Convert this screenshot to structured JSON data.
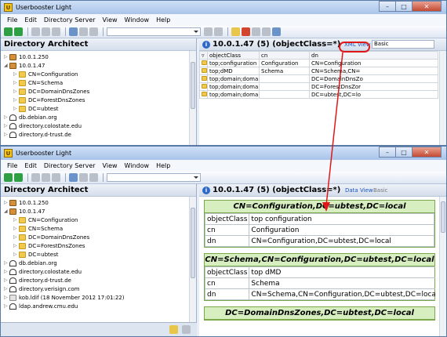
{
  "app": {
    "title": "Userbooster Light"
  },
  "menu": [
    "File",
    "Edit",
    "Directory Server",
    "View",
    "Window",
    "Help"
  ],
  "window1": {
    "pane_title": "Directory Architect",
    "tree": [
      {
        "label": "10.0.1.250",
        "icon": "server-icon",
        "indent": 0,
        "toggle": "▷"
      },
      {
        "label": "10.0.1.47",
        "icon": "server-icon",
        "indent": 0,
        "toggle": "◢"
      },
      {
        "label": "CN=Configuration",
        "icon": "folder-icon",
        "indent": 1,
        "toggle": "▷"
      },
      {
        "label": "CN=Schema",
        "icon": "folder-icon",
        "indent": 1,
        "toggle": "▷"
      },
      {
        "label": "DC=DomainDnsZones",
        "icon": "folder-icon",
        "indent": 1,
        "toggle": "▷"
      },
      {
        "label": "DC=ForestDnsZones",
        "icon": "folder-icon",
        "indent": 1,
        "toggle": "▷"
      },
      {
        "label": "DC=ubtest",
        "icon": "folder-icon",
        "indent": 1,
        "toggle": "▷"
      },
      {
        "label": "db.debian.org",
        "icon": "link-icon",
        "indent": 0,
        "toggle": "▷"
      },
      {
        "label": "directory.colostate.edu",
        "icon": "link-icon",
        "indent": 0,
        "toggle": "▷"
      },
      {
        "label": "directory.d-trust.de",
        "icon": "link-icon",
        "indent": 0,
        "toggle": "▷"
      }
    ],
    "right_title": "10.0.1.47 (5) (objectClass=*)",
    "xml_view": "XML View",
    "basic_field": "Basic",
    "columns": [
      "objectClass",
      "cn",
      "dn"
    ],
    "rows": [
      [
        "top;configuration",
        "Configuration",
        "CN=Configuration"
      ],
      [
        "top;dMD",
        "Schema",
        "CN=Schema,CN="
      ],
      [
        "top;domain;doma",
        "",
        "DC=DomainDnsZo"
      ],
      [
        "top;domain;doma",
        "",
        "DC=ForestDnsZor"
      ],
      [
        "top;domain;doma",
        "",
        "DC=ubtest,DC=lo"
      ]
    ]
  },
  "window2": {
    "pane_title": "Directory Architect",
    "tree": [
      {
        "label": "10.0.1.250",
        "icon": "server-icon",
        "indent": 0,
        "toggle": "▷"
      },
      {
        "label": "10.0.1.47",
        "icon": "server-icon",
        "indent": 0,
        "toggle": "◢"
      },
      {
        "label": "CN=Configuration",
        "icon": "folder-icon",
        "indent": 1,
        "toggle": "▷"
      },
      {
        "label": "CN=Schema",
        "icon": "folder-icon",
        "indent": 1,
        "toggle": "▷"
      },
      {
        "label": "DC=DomainDnsZones",
        "icon": "folder-icon",
        "indent": 1,
        "toggle": "▷"
      },
      {
        "label": "DC=ForestDnsZones",
        "icon": "folder-icon",
        "indent": 1,
        "toggle": "▷"
      },
      {
        "label": "DC=ubtest",
        "icon": "folder-icon",
        "indent": 1,
        "toggle": "▷"
      },
      {
        "label": "db.debian.org",
        "icon": "link-icon",
        "indent": 0,
        "toggle": "▷"
      },
      {
        "label": "directory.colostate.edu",
        "icon": "link-icon",
        "indent": 0,
        "toggle": "▷"
      },
      {
        "label": "directory.d-trust.de",
        "icon": "link-icon",
        "indent": 0,
        "toggle": "▷"
      },
      {
        "label": "directory.verisign.com",
        "icon": "link-icon",
        "indent": 0,
        "toggle": "▷"
      },
      {
        "label": "kob.ldif (18 November 2012 17:01:22)",
        "icon": "file-icon",
        "indent": 0,
        "toggle": "▷"
      },
      {
        "label": "ldap.andrew.cmu.edu",
        "icon": "link-icon",
        "indent": 0,
        "toggle": "▷"
      }
    ],
    "right_title": "10.0.1.47 (5) (objectClass=*)",
    "data_view": "Data View",
    "basic_field": "Basic",
    "records": [
      {
        "title": "CN=Configuration,DC=ubtest,DC=local",
        "attrs": [
          [
            "objectClass",
            "top configuration"
          ],
          [
            "cn",
            "Configuration"
          ],
          [
            "dn",
            "CN=Configuration,DC=ubtest,DC=local"
          ]
        ]
      },
      {
        "title": "CN=Schema,CN=Configuration,DC=ubtest,DC=local",
        "attrs": [
          [
            "objectClass",
            "top dMD"
          ],
          [
            "cn",
            "Schema"
          ],
          [
            "dn",
            "CN=Schema,CN=Configuration,DC=ubtest,DC=local"
          ]
        ]
      },
      {
        "title": "DC=DomainDnsZones,DC=ubtest,DC=local",
        "attrs": []
      }
    ]
  }
}
